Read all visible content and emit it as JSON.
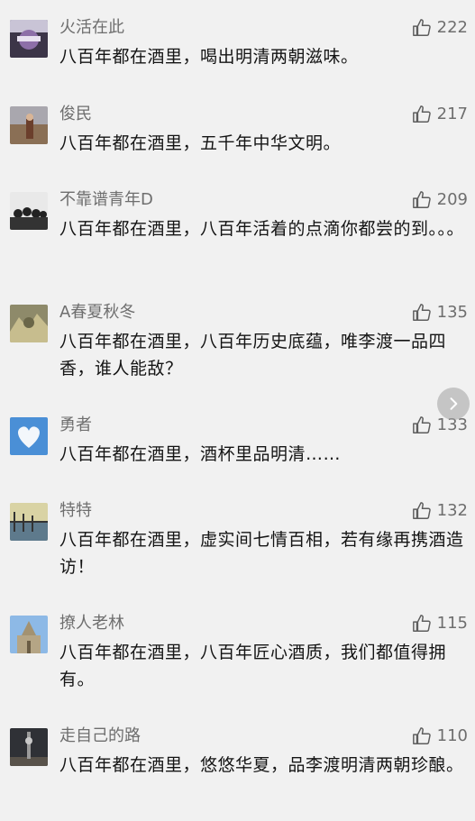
{
  "comments": [
    {
      "nick": "火活在此",
      "likes": "222",
      "text": "八百年都在酒里，喝出明清两朝滋味。"
    },
    {
      "nick": "俊民",
      "likes": "217",
      "text": "八百年都在酒里，五千年中华文明。"
    },
    {
      "nick": "不靠谱青年D",
      "likes": "209",
      "text": "八百年都在酒里，八百年活着的点滴你都尝的到。。。"
    },
    {
      "nick": "A春夏秋冬",
      "likes": "135",
      "text": "八百年都在酒里，八百年历史底蕴，唯李渡一品四香，谁人能敌？"
    },
    {
      "nick": "勇者",
      "likes": "133",
      "text": "八百年都在酒里，酒杯里品明清……"
    },
    {
      "nick": "特特",
      "likes": "132",
      "text": "八百年都在酒里，虚实间七情百相，若有缘再携酒造访！"
    },
    {
      "nick": "撩人老林",
      "likes": "115",
      "text": "八百年都在酒里，八百年匠心酒质，我们都值得拥有。"
    },
    {
      "nick": "走自己的路",
      "likes": "110",
      "text": "八百年都在酒里，悠悠华夏，品李渡明清两朝珍酿。"
    }
  ],
  "icons": {
    "like": "thumbs-up-icon",
    "scroll": "chevron-right-icon"
  },
  "colors": {
    "background": "#f1f1f1",
    "nick": "#6e6e6e",
    "text": "#141414"
  }
}
